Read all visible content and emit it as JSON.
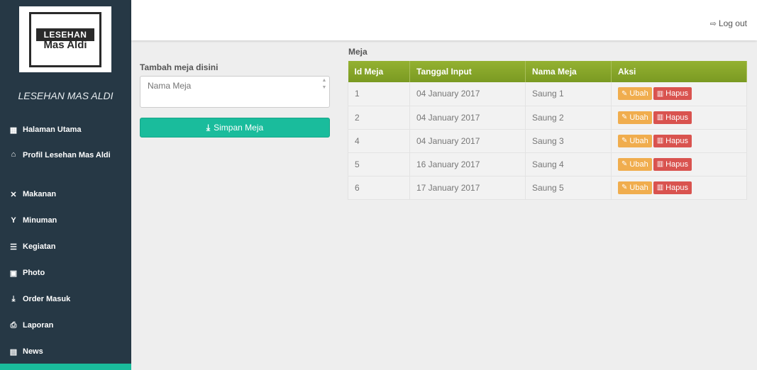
{
  "logo": {
    "line1": "LESEHAN",
    "line2": "Mas Aldi"
  },
  "brand": "LESEHAN MAS ALDI",
  "menu": [
    {
      "label": "Halaman Utama",
      "icon": "th-icon",
      "glyph": "▦"
    },
    {
      "label": "Profil Lesehan Mas Aldi",
      "icon": "home-icon",
      "glyph": "⌂"
    },
    {
      "label": "Makanan",
      "icon": "cutlery-icon",
      "glyph": "✕"
    },
    {
      "label": "Minuman",
      "icon": "glass-icon",
      "glyph": "Y"
    },
    {
      "label": "Kegiatan",
      "icon": "list-icon",
      "glyph": "☰"
    },
    {
      "label": "Photo",
      "icon": "picture-icon",
      "glyph": "▣"
    },
    {
      "label": "Order Masuk",
      "icon": "download-icon",
      "glyph": "⤓"
    },
    {
      "label": "Laporan",
      "icon": "print-icon",
      "glyph": "⎙"
    },
    {
      "label": "News",
      "icon": "news-icon",
      "glyph": "▤"
    }
  ],
  "topbar": {
    "logout": "Log out"
  },
  "form": {
    "label": "Tambah meja disini",
    "placeholder": "Nama Meja",
    "submit": "Simpan Meja"
  },
  "table": {
    "title": "Meja",
    "headers": [
      "Id Meja",
      "Tanggal Input",
      "Nama Meja",
      "Aksi"
    ],
    "rows": [
      {
        "id": "1",
        "tanggal": "04 January 2017",
        "nama": "Saung 1"
      },
      {
        "id": "2",
        "tanggal": "04 January 2017",
        "nama": "Saung 2"
      },
      {
        "id": "4",
        "tanggal": "04 January 2017",
        "nama": "Saung 3"
      },
      {
        "id": "5",
        "tanggal": "16 January 2017",
        "nama": "Saung 4"
      },
      {
        "id": "6",
        "tanggal": "17 January 2017",
        "nama": "Saung 5"
      }
    ],
    "edit_label": "Ubah",
    "delete_label": "Hapus"
  },
  "colors": {
    "sidebar": "#263845",
    "accent": "#1abc9c",
    "table_header": "#85a229",
    "edit": "#f0ad4e",
    "delete": "#d9534f"
  }
}
